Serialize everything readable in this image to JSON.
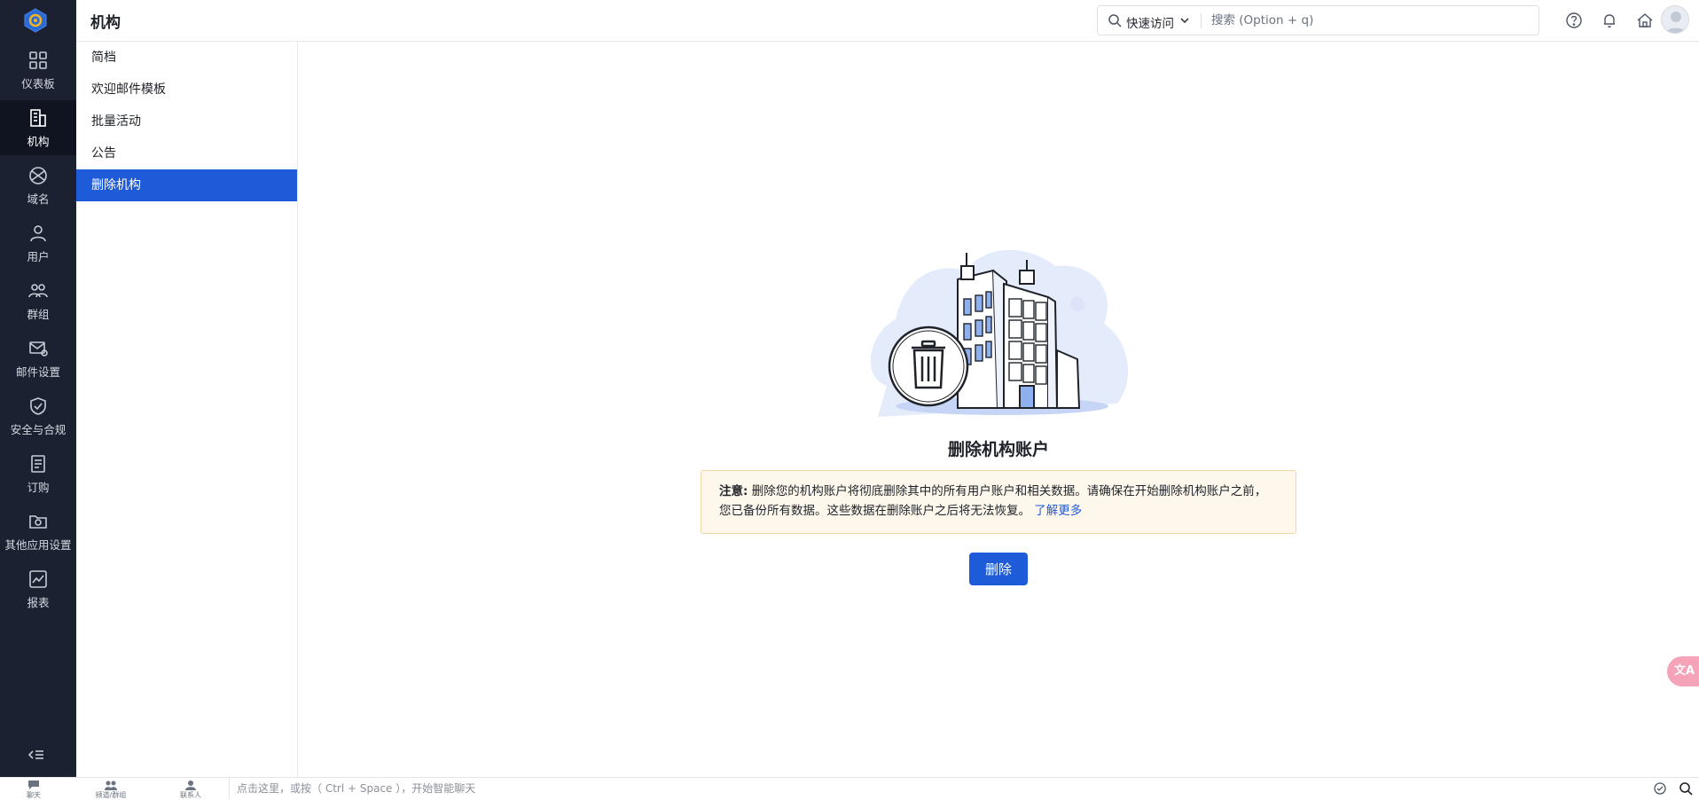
{
  "app": {
    "page_title": "机构"
  },
  "nav": {
    "items": [
      {
        "label": "仪表板",
        "icon": "dashboard-icon"
      },
      {
        "label": "机构",
        "icon": "building-icon",
        "active": true
      },
      {
        "label": "域名",
        "icon": "globe-icon"
      },
      {
        "label": "用户",
        "icon": "user-icon"
      },
      {
        "label": "群组",
        "icon": "group-icon"
      },
      {
        "label": "邮件设置",
        "icon": "mail-settings-icon"
      },
      {
        "label": "安全与合规",
        "icon": "shield-check-icon"
      },
      {
        "label": "订购",
        "icon": "subscription-icon"
      },
      {
        "label": "其他应用设置",
        "icon": "app-settings-icon"
      },
      {
        "label": "报表",
        "icon": "chart-icon"
      }
    ]
  },
  "header": {
    "quick_access": "快速访问",
    "search_placeholder": "搜索 (Option + q)"
  },
  "submenu": {
    "items": [
      {
        "label": "简档"
      },
      {
        "label": "欢迎邮件模板"
      },
      {
        "label": "批量活动"
      },
      {
        "label": "公告"
      },
      {
        "label": "删除机构",
        "active": true
      }
    ]
  },
  "main": {
    "title": "删除机构账户",
    "notice_prefix": "注意:",
    "notice_text": "删除您的机构账户将彻底删除其中的所有用户账户和相关数据。请确保在开始删除机构账户之前，您已备份所有数据。这些数据在删除账户之后将无法恢复。",
    "learn_more": "了解更多",
    "delete_button": "删除"
  },
  "floating": {
    "translate_label": "文A"
  },
  "bottombar": {
    "items": [
      {
        "label": "聊天",
        "icon": "chat-icon"
      },
      {
        "label": "频道/群组",
        "icon": "channels-icon"
      },
      {
        "label": "联系人",
        "icon": "contacts-icon"
      }
    ],
    "chat_placeholder": "点击这里，或按（ Ctrl + Space ），开始智能聊天"
  },
  "colors": {
    "accent": "#1e5bd8",
    "rail_bg": "#1b2130",
    "notice_bg": "#fef7ec"
  }
}
